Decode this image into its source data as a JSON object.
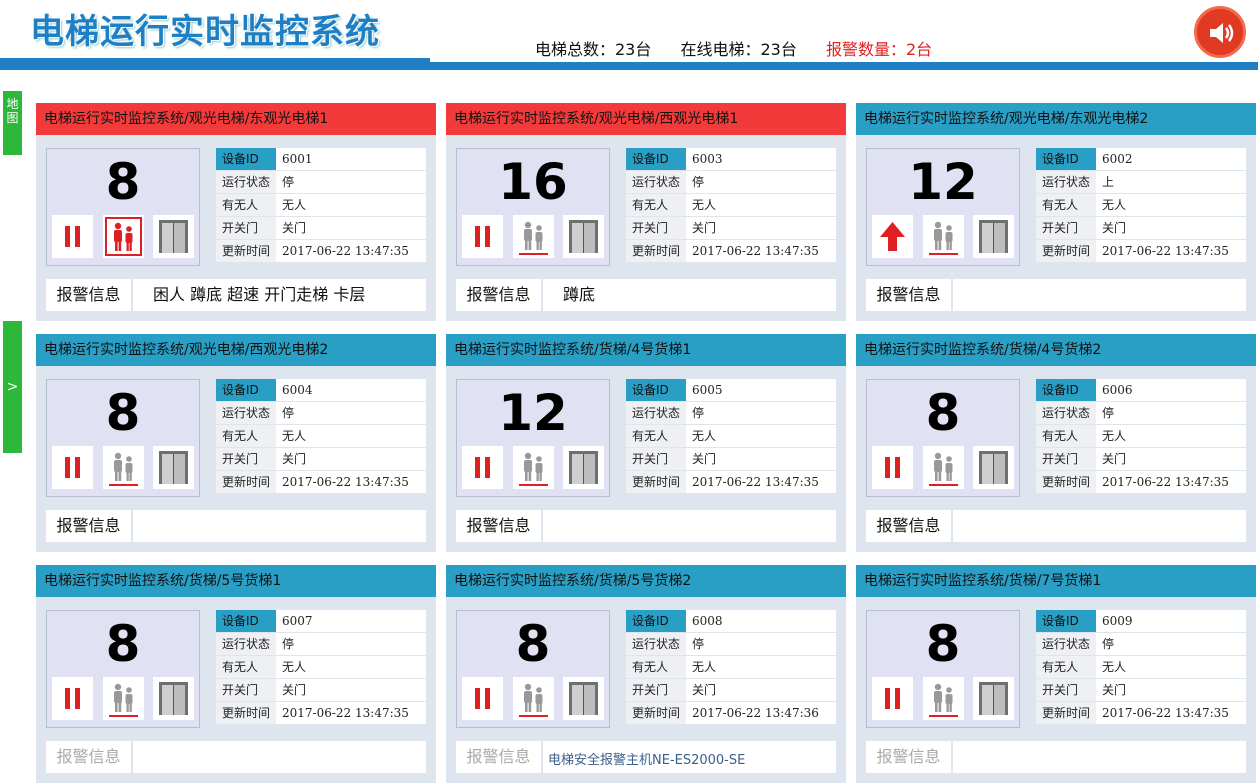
{
  "header": {
    "title": "电梯运行实时监控系统",
    "total": "电梯总数：23台",
    "online": "在线电梯：23台",
    "alarm": "报警数量：2台"
  },
  "sidebar": {
    "map_label": "地图",
    "toggle_label": ">"
  },
  "labels": {
    "device_id": "设备ID",
    "run_status": "运行状态",
    "occupied": "有无人",
    "door": "开关门",
    "updated": "更新时间",
    "alarm_info": "报警信息"
  },
  "colors": {
    "accent": "#2a9fc6",
    "alarm": "#f23a3a",
    "brand": "#1e7fc4"
  },
  "elevators": [
    {
      "path": "电梯运行实时监控系统/观光电梯/东观光电梯1",
      "floor": "8",
      "device_id": "6001",
      "status": "停",
      "occupied": "无人",
      "door": "关门",
      "updated": "2017-06-22 13:47:35",
      "alarms": "困人 蹲底 超速 开门走梯 卡层",
      "state": "alarm"
    },
    {
      "path": "电梯运行实时监控系统/观光电梯/西观光电梯1",
      "floor": "16",
      "device_id": "6003",
      "status": "停",
      "occupied": "无人",
      "door": "关门",
      "updated": "2017-06-22 13:47:35",
      "alarms": "蹲底",
      "state": "alarm"
    },
    {
      "path": "电梯运行实时监控系统/观光电梯/东观光电梯2",
      "floor": "12",
      "device_id": "6002",
      "status": "上",
      "occupied": "无人",
      "door": "关门",
      "updated": "2017-06-22 13:47:35",
      "alarms": "",
      "state": "up"
    },
    {
      "path": "电梯运行实时监控系统/观光电梯/西观光电梯2",
      "floor": "8",
      "device_id": "6004",
      "status": "停",
      "occupied": "无人",
      "door": "关门",
      "updated": "2017-06-22 13:47:35",
      "alarms": "",
      "state": "stop"
    },
    {
      "path": "电梯运行实时监控系统/货梯/4号货梯1",
      "floor": "12",
      "device_id": "6005",
      "status": "停",
      "occupied": "无人",
      "door": "关门",
      "updated": "2017-06-22 13:47:35",
      "alarms": "",
      "state": "stop"
    },
    {
      "path": "电梯运行实时监控系统/货梯/4号货梯2",
      "floor": "8",
      "device_id": "6006",
      "status": "停",
      "occupied": "无人",
      "door": "关门",
      "updated": "2017-06-22 13:47:35",
      "alarms": "",
      "state": "stop"
    },
    {
      "path": "电梯运行实时监控系统/货梯/5号货梯1",
      "floor": "8",
      "device_id": "6007",
      "status": "停",
      "occupied": "无人",
      "door": "关门",
      "updated": "2017-06-22 13:47:35",
      "alarms": "",
      "state": "stop"
    },
    {
      "path": "电梯运行实时监控系统/货梯/5号货梯2",
      "floor": "8",
      "device_id": "6008",
      "status": "停",
      "occupied": "无人",
      "door": "关门",
      "updated": "2017-06-22 13:47:36",
      "alarms": "",
      "state": "stop"
    },
    {
      "path": "电梯运行实时监控系统/货梯/7号货梯1",
      "floor": "8",
      "device_id": "6009",
      "status": "停",
      "occupied": "无人",
      "door": "关门",
      "updated": "2017-06-22 13:47:35",
      "alarms": "",
      "state": "stop"
    }
  ],
  "footer": {
    "text": "电梯安全报警主机NE-ES2000-SE"
  }
}
